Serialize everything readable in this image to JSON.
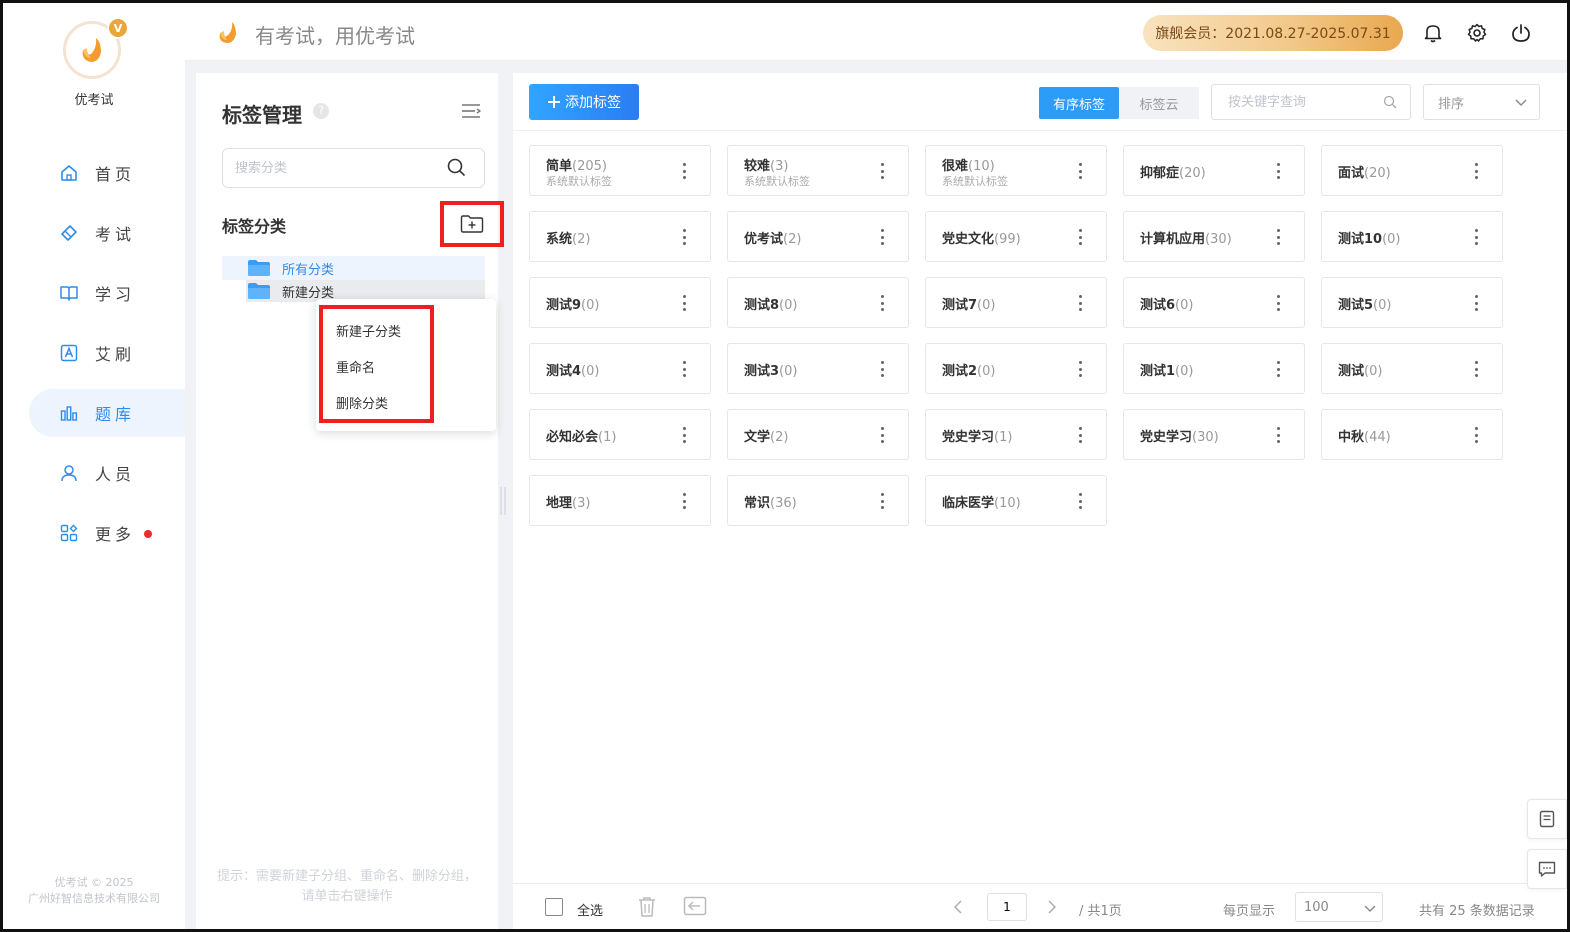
{
  "app": {
    "brand_name": "优考试",
    "vip_badge": "V",
    "slogan": "有考试，用优考试",
    "member_text": "旗舰会员：2021.08.27-2025.07.31",
    "copyright_line1": "优考试 © 2025",
    "copyright_line2": "广州好智信息技术有限公司"
  },
  "colors": {
    "accent": "#2d8cf0",
    "highlight_box": "#ee1f1f",
    "member_gradient_start": "#f9e3bf",
    "member_gradient_end": "#e9a84f"
  },
  "nav": [
    {
      "label": "首页",
      "icon": "home-icon"
    },
    {
      "label": "考试",
      "icon": "eraser-icon"
    },
    {
      "label": "学习",
      "icon": "book-icon"
    },
    {
      "label": "艾刷",
      "icon": "a-box-icon"
    },
    {
      "label": "题库",
      "icon": "bar-chart-icon",
      "active": true
    },
    {
      "label": "人员",
      "icon": "user-icon"
    },
    {
      "label": "更多",
      "icon": "apps-icon",
      "has_dot": true
    }
  ],
  "left_panel": {
    "title": "标签管理",
    "help": "?",
    "search_placeholder": "搜索分类",
    "category_label": "标签分类",
    "tree": {
      "all": "所有分类",
      "new": "新建分类"
    },
    "context_menu": [
      "新建子分类",
      "重命名",
      "删除分类"
    ],
    "hint": "提示：需要新建子分组、重命名、删除分组，请单击右键操作"
  },
  "toolbar": {
    "add_label": "添加标签",
    "segments": [
      "有序标签",
      "标签云"
    ],
    "keyword_placeholder": "按关键字查询",
    "sort_label": "排序"
  },
  "tags": [
    {
      "name": "简单",
      "count": "(205)",
      "sub": "系统默认标签"
    },
    {
      "name": "较难",
      "count": "(3)",
      "sub": "系统默认标签"
    },
    {
      "name": "很难",
      "count": "(10)",
      "sub": "系统默认标签"
    },
    {
      "name": "抑郁症",
      "count": "(20)",
      "sub": ""
    },
    {
      "name": "面试",
      "count": "(20)",
      "sub": ""
    },
    {
      "name": "系统",
      "count": "(2)",
      "sub": ""
    },
    {
      "name": "优考试",
      "count": "(2)",
      "sub": ""
    },
    {
      "name": "党史文化",
      "count": "(99)",
      "sub": ""
    },
    {
      "name": "计算机应用",
      "count": "(30)",
      "sub": ""
    },
    {
      "name": "测试10",
      "count": "(0)",
      "sub": ""
    },
    {
      "name": "测试9",
      "count": "(0)",
      "sub": ""
    },
    {
      "name": "测试8",
      "count": "(0)",
      "sub": ""
    },
    {
      "name": "测试7",
      "count": "(0)",
      "sub": ""
    },
    {
      "name": "测试6",
      "count": "(0)",
      "sub": ""
    },
    {
      "name": "测试5",
      "count": "(0)",
      "sub": ""
    },
    {
      "name": "测试4",
      "count": "(0)",
      "sub": ""
    },
    {
      "name": "测试3",
      "count": "(0)",
      "sub": ""
    },
    {
      "name": "测试2",
      "count": "(0)",
      "sub": ""
    },
    {
      "name": "测试1",
      "count": "(0)",
      "sub": ""
    },
    {
      "name": "测试",
      "count": "(0)",
      "sub": ""
    },
    {
      "name": "必知必会",
      "count": "(1)",
      "sub": ""
    },
    {
      "name": "文学",
      "count": "(2)",
      "sub": ""
    },
    {
      "name": "党史学习",
      "count": "(1)",
      "sub": ""
    },
    {
      "name": "党史学习",
      "count": "(30)",
      "sub": ""
    },
    {
      "name": "中秋",
      "count": "(44)",
      "sub": ""
    },
    {
      "name": "地理",
      "count": "(3)",
      "sub": ""
    },
    {
      "name": "常识",
      "count": "(36)",
      "sub": ""
    },
    {
      "name": "临床医学",
      "count": "(10)",
      "sub": ""
    }
  ],
  "bottom": {
    "select_all": "全选",
    "page_value": "1",
    "page_total": "/ 共1页",
    "per_page_label": "每页显示",
    "per_page_value": "100",
    "record_total": "共有 25 条数据记录"
  }
}
